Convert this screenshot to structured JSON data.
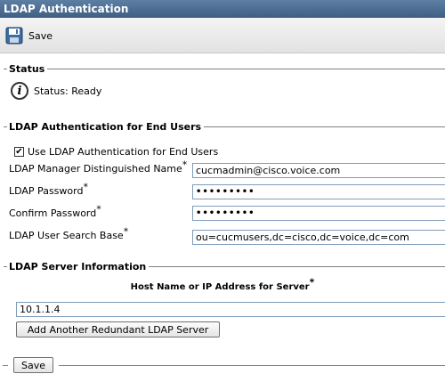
{
  "title": "LDAP Authentication",
  "toolbar": {
    "save_label": "Save"
  },
  "status": {
    "legend": "Status",
    "text": "Status: Ready"
  },
  "end_users": {
    "legend": "LDAP Authentication for End Users",
    "checkbox_label": "Use LDAP Authentication for End Users",
    "checkbox_checked": true,
    "manager_dn_label": "LDAP Manager Distinguished Name",
    "manager_dn_value": "cucmadmin@cisco.voice.com",
    "password_label": "LDAP Password",
    "password_value": "•••••••••",
    "confirm_label": "Confirm Password",
    "confirm_value": "•••••••••",
    "search_base_label": "LDAP User Search Base",
    "search_base_value": "ou=cucmusers,dc=cisco,dc=voice,dc=com",
    "required_mark": "*"
  },
  "server_info": {
    "legend": "LDAP Server Information",
    "host_header": "Host Name or IP Address for Server",
    "host_value": "10.1.1.4",
    "add_button": "Add Another Redundant LDAP Server"
  },
  "bottom": {
    "save_label": "Save"
  }
}
